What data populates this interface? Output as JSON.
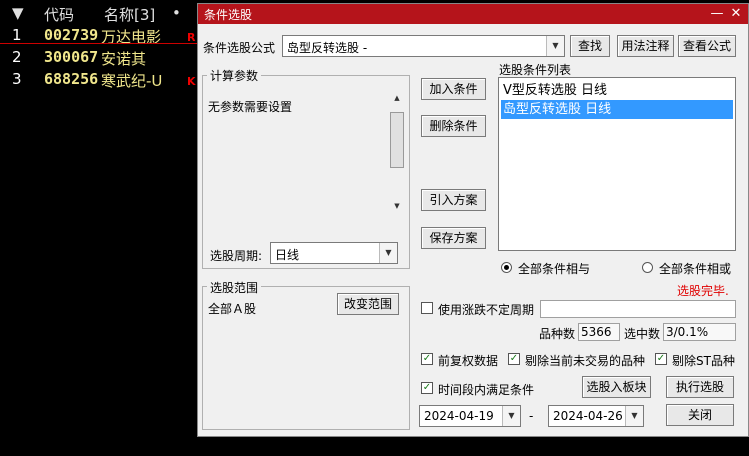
{
  "stock_list": {
    "header": {
      "arrow": "▼",
      "code": "代码",
      "name": "名称[3]",
      "dot": "•"
    },
    "rows": [
      {
        "num": "1",
        "code": "002739",
        "name": "万达电影",
        "tag": "R"
      },
      {
        "num": "2",
        "code": "300067",
        "name": "安诺其",
        "tag": ""
      },
      {
        "num": "3",
        "code": "688256",
        "name": "寒武纪-U",
        "tag": "K"
      }
    ]
  },
  "dialog": {
    "title": "条件选股",
    "minimize": "—",
    "close": "✕",
    "formula_label": "条件选股公式",
    "formula_value": "岛型反转选股 -",
    "find_button": "查找",
    "usage_button": "用法注释",
    "view_formula_button": "查看公式",
    "params_group": "计算参数",
    "params_text": "无参数需要设置",
    "period_label": "选股周期:",
    "period_value": "日线",
    "add_condition": "加入条件",
    "delete_condition": "删除条件",
    "import_plan": "引入方案",
    "save_plan": "保存方案",
    "conditions_label": "选股条件列表",
    "conditions": [
      "V型反转选股  日线",
      "岛型反转选股  日线"
    ],
    "selected_condition_index": 1,
    "radio_and": "全部条件相与",
    "radio_or": "全部条件相或",
    "status": "选股完毕.",
    "range_group": "选股范围",
    "range_value": "全部Ａ股",
    "change_range": "改变范围",
    "use_uncertain_period": "使用涨跌不定周期",
    "count_label": "品种数",
    "count_value": "5366",
    "hit_label": "选中数",
    "hit_value": "3/0.1%",
    "check_adjusted": "前复权数据",
    "check_exclude_untraded": "剔除当前未交易的品种",
    "check_exclude_st": "剔除ST品种",
    "check_time_range": "时间段内满足条件",
    "to_block_button": "选股入板块",
    "execute_button": "执行选股",
    "date_start": "2024-04-19",
    "date_separator": "-",
    "date_end": "2024-04-26",
    "close_button": "关闭",
    "checkmark": "✓",
    "colors": {
      "titlebar": "#b5141b",
      "selection": "#3399ff",
      "status": "#e00000"
    }
  }
}
